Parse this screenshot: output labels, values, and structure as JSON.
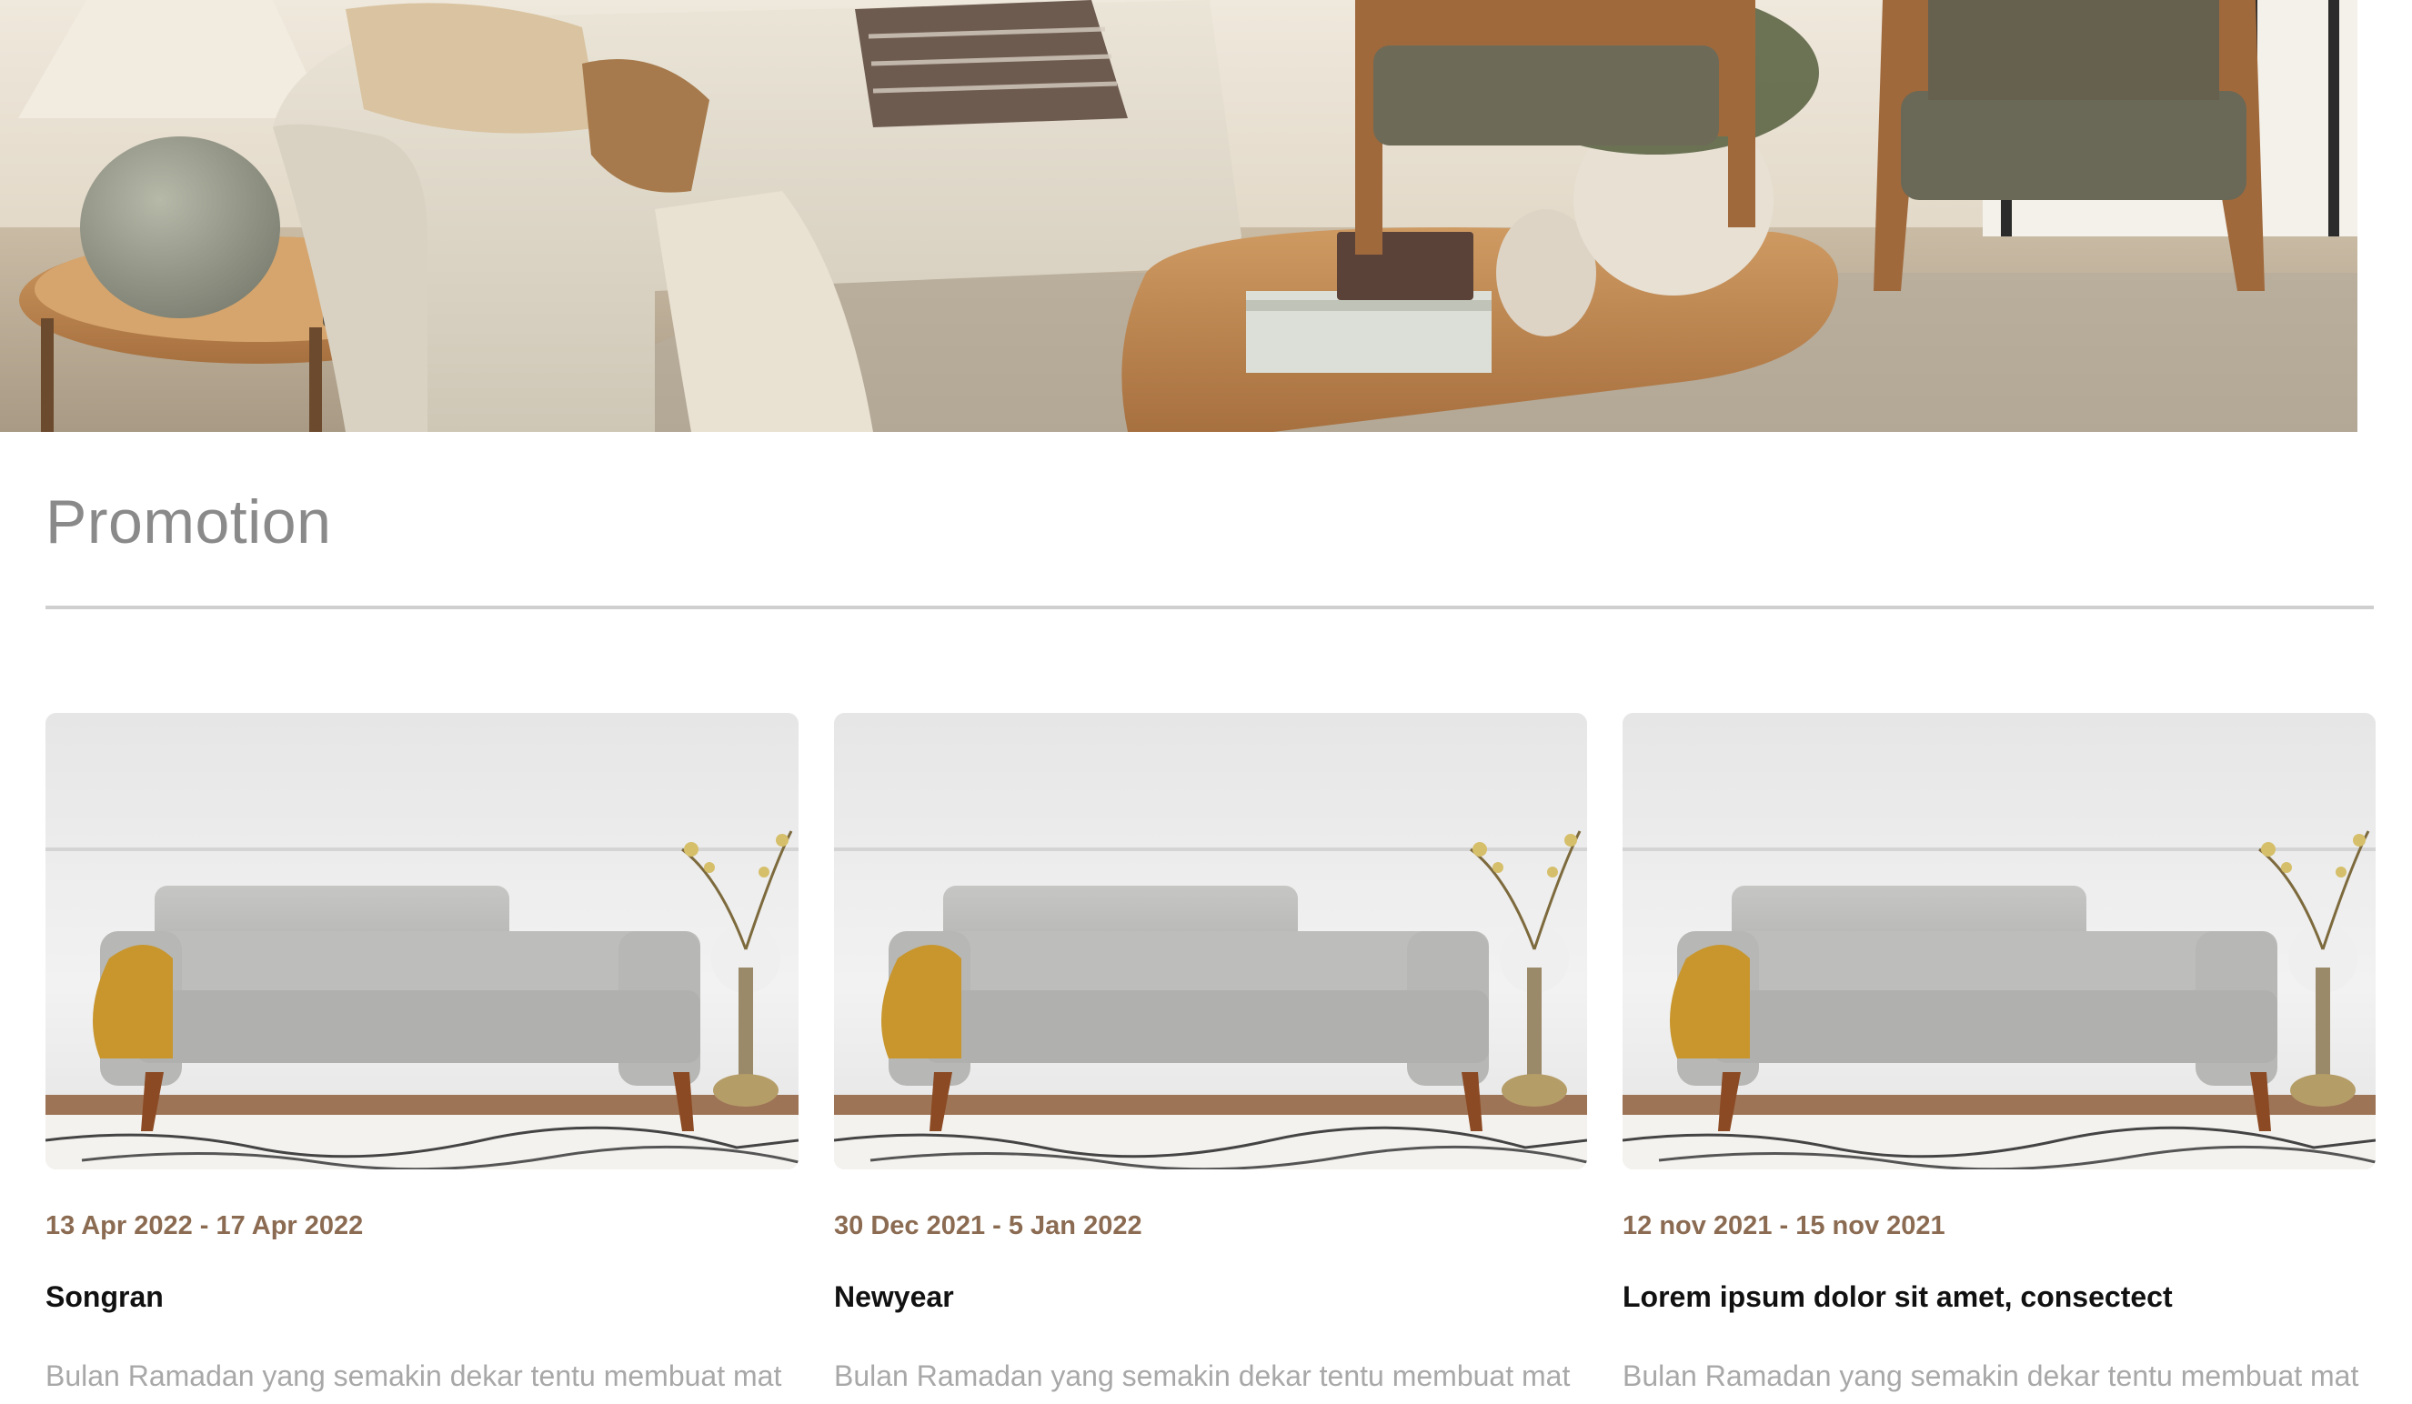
{
  "hero": {
    "image": "living-room-banner"
  },
  "promotion": {
    "title": "Promotion",
    "cards": [
      {
        "image": "grey-sofa-photo",
        "date": "13 Apr 2022 - 17 Apr 2022",
        "title": "Songran",
        "description": "Bulan Ramadan yang semakin dekar tentu membuat mat"
      },
      {
        "image": "grey-sofa-photo",
        "date": "30 Dec 2021 - 5 Jan 2022",
        "title": "Newyear",
        "description": "Bulan Ramadan yang semakin dekar tentu membuat mat"
      },
      {
        "image": "grey-sofa-photo",
        "date": "12 nov 2021 - 15 nov 2021",
        "title": "Lorem ipsum dolor sit amet, consectect",
        "description": "Bulan Ramadan yang semakin dekar tentu membuat mat"
      }
    ]
  },
  "colors": {
    "date": "#8b6b52",
    "title": "#111111",
    "description": "#a8a8a8",
    "heading": "#8a8a8a",
    "divider": "#cfcfcf"
  }
}
